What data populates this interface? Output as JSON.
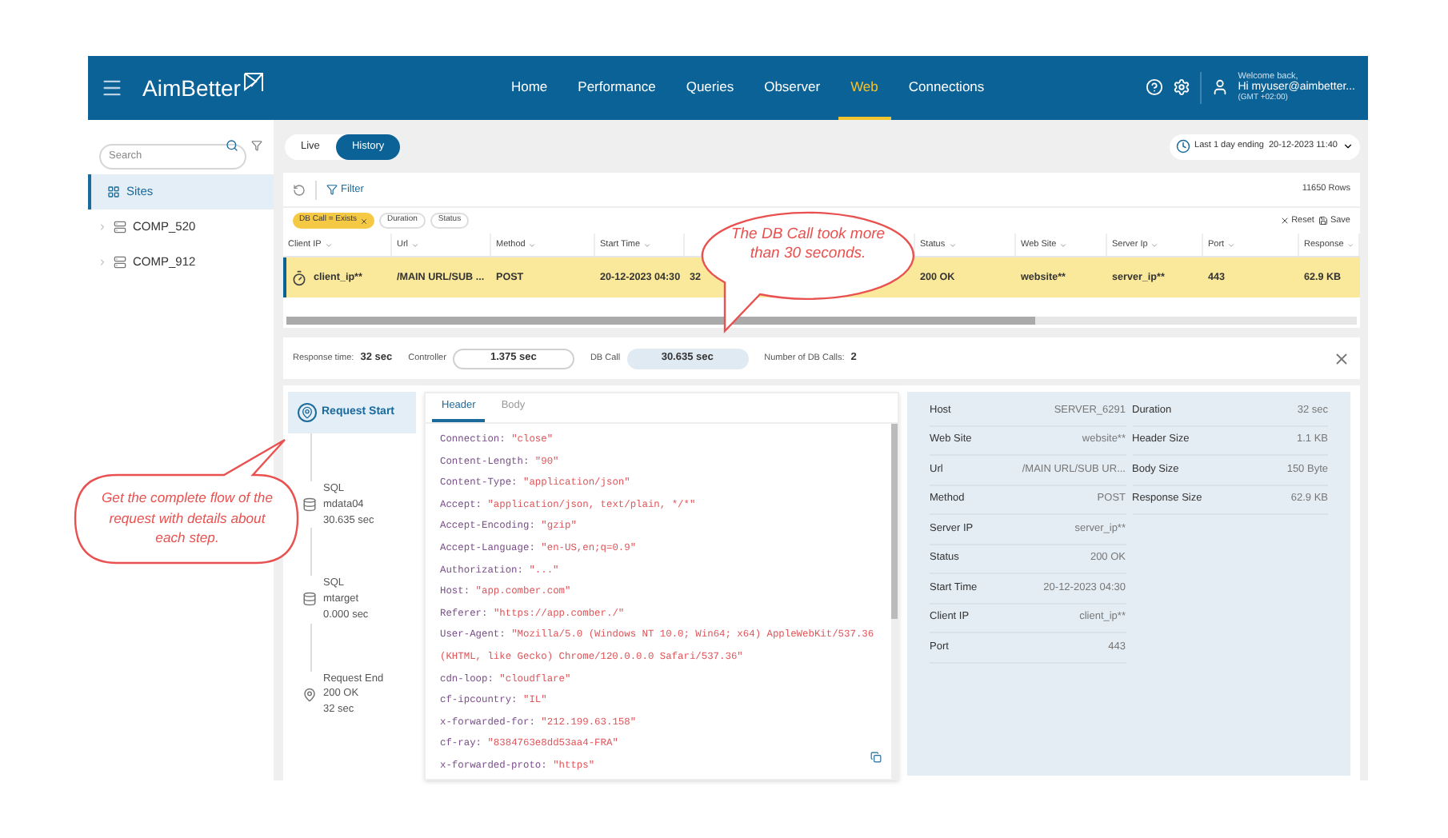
{
  "nav": {
    "logo": "AimBetter",
    "items": [
      {
        "label": "Home",
        "selected": false
      },
      {
        "label": "Performance",
        "selected": false
      },
      {
        "label": "Queries",
        "selected": false
      },
      {
        "label": "Observer",
        "selected": false
      },
      {
        "label": "Web",
        "selected": true
      },
      {
        "label": "Connections",
        "selected": false
      }
    ],
    "user": {
      "greeting": "Welcome back,",
      "name": "Hi myuser@aimbetter...",
      "timezone": "(GMT +02:00)"
    }
  },
  "sidebar": {
    "search": {
      "placeholder": "Search"
    },
    "items": [
      {
        "label": "Sites",
        "kind": "root",
        "selected": true
      },
      {
        "label": "COMP_520",
        "kind": "server",
        "selected": false
      },
      {
        "label": "COMP_912",
        "kind": "server",
        "selected": false
      }
    ]
  },
  "mode_toggle": [
    {
      "label": "Live",
      "selected": false
    },
    {
      "label": "History",
      "selected": true
    }
  ],
  "time_range": {
    "label": "Last 1 day ending",
    "value": "20-12-2023 11:40"
  },
  "toolbar": {
    "filter": "Filter",
    "row_count": "11650 Rows",
    "reset": "Reset",
    "save": "Save",
    "chips": [
      {
        "label": "DB Call = Exists",
        "active": true
      },
      {
        "label": "Duration",
        "active": false
      },
      {
        "label": "Status",
        "active": false
      }
    ]
  },
  "table": {
    "columns": [
      {
        "label": "Client IP"
      },
      {
        "label": "Url"
      },
      {
        "label": "Method"
      },
      {
        "label": "Start Time"
      },
      {},
      {
        "label": "Status"
      },
      {
        "label": "Web Site"
      },
      {
        "label": "Server Ip"
      },
      {
        "label": "Port"
      },
      {
        "label": "Response"
      }
    ],
    "rows": [
      {
        "selected": true,
        "cells": [
          "client_ip**",
          "/MAIN URL/SUB ...",
          "POST",
          "20-12-2023 04:30",
          "32",
          "200 OK",
          "website**",
          "server_ip**",
          "443",
          "62.9 KB"
        ]
      }
    ]
  },
  "summary": [
    {
      "label": "Response time:",
      "value": "32 sec",
      "kind": "plain"
    },
    {
      "label": "Controller",
      "value": "1.375 sec",
      "kind": "bar",
      "highlighted": false
    },
    {
      "label": "DB Call",
      "value": "30.635 sec",
      "kind": "bar",
      "highlighted": true
    },
    {
      "label": "Number of DB Calls:",
      "value": "2",
      "kind": "plain"
    }
  ],
  "timeline": [
    {
      "kind": "start",
      "lines": [
        "Request Start"
      ],
      "selected": true
    },
    {
      "kind": "sql",
      "lines": [
        "SQL",
        "mdata04",
        "30.635 sec"
      ],
      "selected": false
    },
    {
      "kind": "sql",
      "lines": [
        "SQL",
        "mtarget",
        "0.000 sec"
      ],
      "selected": false
    },
    {
      "kind": "end",
      "lines": [
        "Request End",
        "200 OK",
        "32 sec"
      ],
      "selected": false
    }
  ],
  "request_panel": {
    "tabs": [
      {
        "label": "Header",
        "selected": true
      },
      {
        "label": "Body",
        "selected": false
      }
    ],
    "headers": [
      {
        "name": "Connection:",
        "value": "\"close\""
      },
      {
        "name": "Content-Length:",
        "value": "\"90\""
      },
      {
        "name": "Content-Type:",
        "value": "\"application/json\""
      },
      {
        "name": "Accept:",
        "value": "\"application/json, text/plain, */*\""
      },
      {
        "name": "Accept-Encoding:",
        "value": "\"gzip\""
      },
      {
        "name": "Accept-Language:",
        "value": "\"en-US,en;q=0.9\""
      },
      {
        "name": "Authorization:",
        "value": "\"...\""
      },
      {
        "name": "Host:",
        "value": "\"app.comber.com\""
      },
      {
        "name": "Referer:",
        "value": "\"https://app.comber./\""
      },
      {
        "name": "User-Agent:",
        "value": "\"Mozilla/5.0 (Windows NT 10.0; Win64; x64) AppleWebKit/537.36 (KHTML, like Gecko) Chrome/120.0.0.0 Safari/537.36\""
      },
      {
        "name": "cdn-loop:",
        "value": "\"cloudflare\""
      },
      {
        "name": "cf-ipcountry:",
        "value": "\"IL\""
      },
      {
        "name": "x-forwarded-for:",
        "value": "\"212.199.63.158\""
      },
      {
        "name": "cf-ray:",
        "value": "\"8384763e8dd53aa4-FRA\""
      },
      {
        "name": "x-forwarded-proto:",
        "value": "\"https\""
      }
    ]
  },
  "details": {
    "left": [
      {
        "label": "Host",
        "value": "SERVER_6291"
      },
      {
        "label": "Web Site",
        "value": "website**"
      },
      {
        "label": "Url",
        "value": "/MAIN URL/SUB UR..."
      },
      {
        "label": "Method",
        "value": "POST"
      },
      {
        "label": "Server IP",
        "value": "server_ip**"
      },
      {
        "label": "Status",
        "value": "200 OK"
      },
      {
        "label": "Start Time",
        "value": "20-12-2023 04:30"
      },
      {
        "label": "Client IP",
        "value": "client_ip**"
      },
      {
        "label": "Port",
        "value": "443"
      }
    ],
    "right": [
      {
        "label": "Duration",
        "value": "32 sec"
      },
      {
        "label": "Header Size",
        "value": "1.1 KB"
      },
      {
        "label": "Body Size",
        "value": "150 Byte"
      },
      {
        "label": "Response Size",
        "value": "62.9 KB"
      }
    ]
  },
  "callouts": [
    {
      "text": "The DB Call took more than 30 seconds."
    },
    {
      "text": "Get the complete flow of the request with details about each step."
    }
  ]
}
